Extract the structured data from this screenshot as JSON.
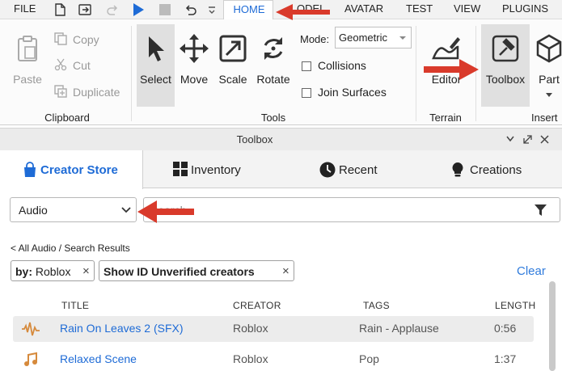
{
  "menubar": {
    "file_label": "FILE",
    "tabs": [
      "HOME",
      "MODEL",
      "AVATAR",
      "TEST",
      "VIEW",
      "PLUGINS"
    ],
    "partial_model_label": "ODEL"
  },
  "ribbon": {
    "clipboard": {
      "paste_label": "Paste",
      "copy_label": "Copy",
      "cut_label": "Cut",
      "duplicate_label": "Duplicate",
      "group_label": "Clipboard"
    },
    "tools": {
      "select_label": "Select",
      "move_label": "Move",
      "scale_label": "Scale",
      "rotate_label": "Rotate",
      "mode_label": "Mode:",
      "mode_value": "Geometric",
      "collisions_label": "Collisions",
      "join_surfaces_label": "Join Surfaces",
      "group_label": "Tools"
    },
    "terrain": {
      "editor_label": "Editor",
      "group_label": "Terrain"
    },
    "insert": {
      "toolbox_label": "Toolbox",
      "part_label": "Part",
      "group_label": "Insert"
    }
  },
  "toolbox": {
    "title": "Toolbox",
    "tabs": {
      "creator_store": "Creator Store",
      "inventory": "Inventory",
      "recent": "Recent",
      "creations": "Creations"
    },
    "category_value": "Audio",
    "search_placeholder": "Search",
    "breadcrumb": "< All Audio / Search Results",
    "chips": {
      "by_label": "by:",
      "by_value": "Roblox",
      "unverified_label": "Show ID Unverified creators"
    },
    "clear_label": "Clear",
    "columns": {
      "title": "TITLE",
      "creator": "CREATOR",
      "tags": "TAGS",
      "length": "LENGTH"
    },
    "rows": [
      {
        "title": "Rain On Leaves 2 (SFX)",
        "creator": "Roblox",
        "tags": "Rain - Applause",
        "length": "0:56",
        "icon": "waveform-icon"
      },
      {
        "title": "Relaxed Scene",
        "creator": "Roblox",
        "tags": "Pop",
        "length": "1:37",
        "icon": "music-note-icon"
      }
    ]
  },
  "colors": {
    "accent_blue": "#1e6bd6",
    "link_blue": "#2f7bdc",
    "annotation_red": "#d93a2b",
    "row_icon_orange": "#d68a3c",
    "selected_tool_bg": "#e0e0e0"
  }
}
